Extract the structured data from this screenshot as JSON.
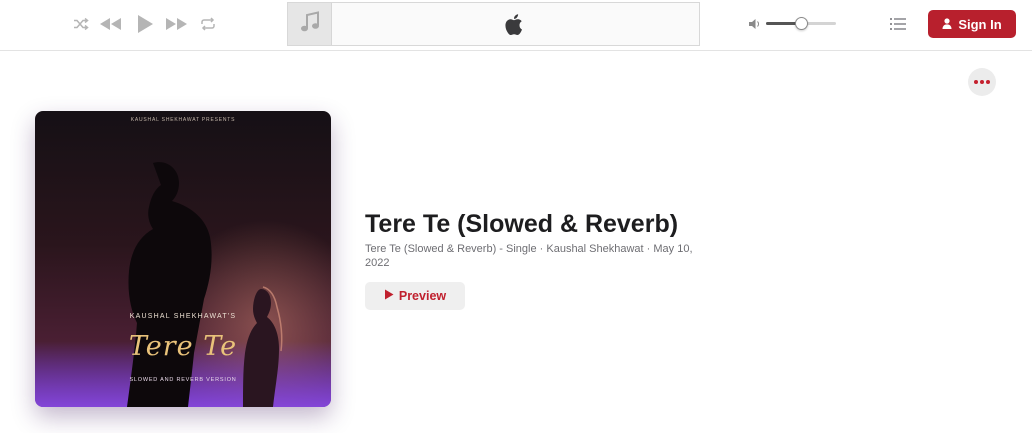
{
  "player": {
    "controls": [
      "shuffle",
      "previous",
      "play",
      "next",
      "repeat"
    ],
    "volume_level": 0.5
  },
  "header": {
    "signin_label": "Sign In"
  },
  "artwork": {
    "presents": "KAUSHAL SHEKHAWAT PRESENTS",
    "artist_line": "KAUSHAL SHEKHAWAT'S",
    "title_script": "Tere Te",
    "subtitle": "SLOWED AND REVERB VERSION"
  },
  "album": {
    "title": "Tere Te (Slowed & Reverb)",
    "meta": "Tere Te (Slowed & Reverb) - Single · Kaushal Shekhawat · May 10, 2022",
    "preview_label": "Preview"
  },
  "colors": {
    "accent": "#b8202d",
    "text_primary": "#1d1d1f",
    "text_secondary": "#6e6e73"
  }
}
